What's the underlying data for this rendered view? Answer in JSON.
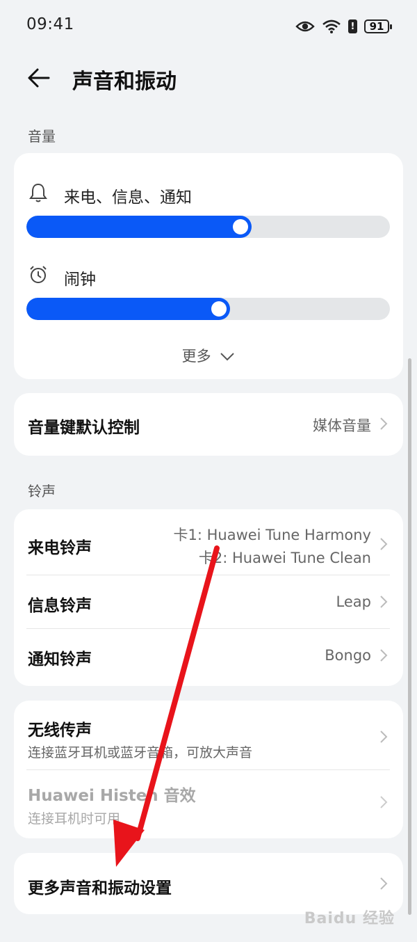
{
  "status_bar": {
    "time": "09:41",
    "battery": "91",
    "alert": "!"
  },
  "header": {
    "title": "声音和振动"
  },
  "volume": {
    "section_label": "音量",
    "sliders": [
      {
        "label": "来电、信息、通知",
        "icon": "bell-icon",
        "level": 0.62
      },
      {
        "label": "闹钟",
        "icon": "alarm-clock-icon",
        "level": 0.56
      }
    ],
    "more_label": "更多"
  },
  "volume_key": {
    "label": "音量键默认控制",
    "value": "媒体音量"
  },
  "ringtone": {
    "section_label": "铃声",
    "call": {
      "label": "来电铃声",
      "value_line1": "卡1: Huawei Tune Harmony",
      "value_line2": "卡2: Huawei Tune Clean"
    },
    "message": {
      "label": "信息铃声",
      "value": "Leap"
    },
    "notification": {
      "label": "通知铃声",
      "value": "Bongo"
    }
  },
  "wireless": {
    "title": "无线传声",
    "subtitle": "连接蓝牙耳机或蓝牙音箱，可放大声音",
    "histen_title": "Huawei Histen 音效",
    "histen_subtitle": "连接耳机时可用"
  },
  "more_settings": {
    "label": "更多声音和振动设置"
  },
  "watermark": "Baidu 经验",
  "colors": {
    "accent": "#0a59f7",
    "background": "#f1f3f5",
    "annotation_arrow": "#e8141b"
  }
}
